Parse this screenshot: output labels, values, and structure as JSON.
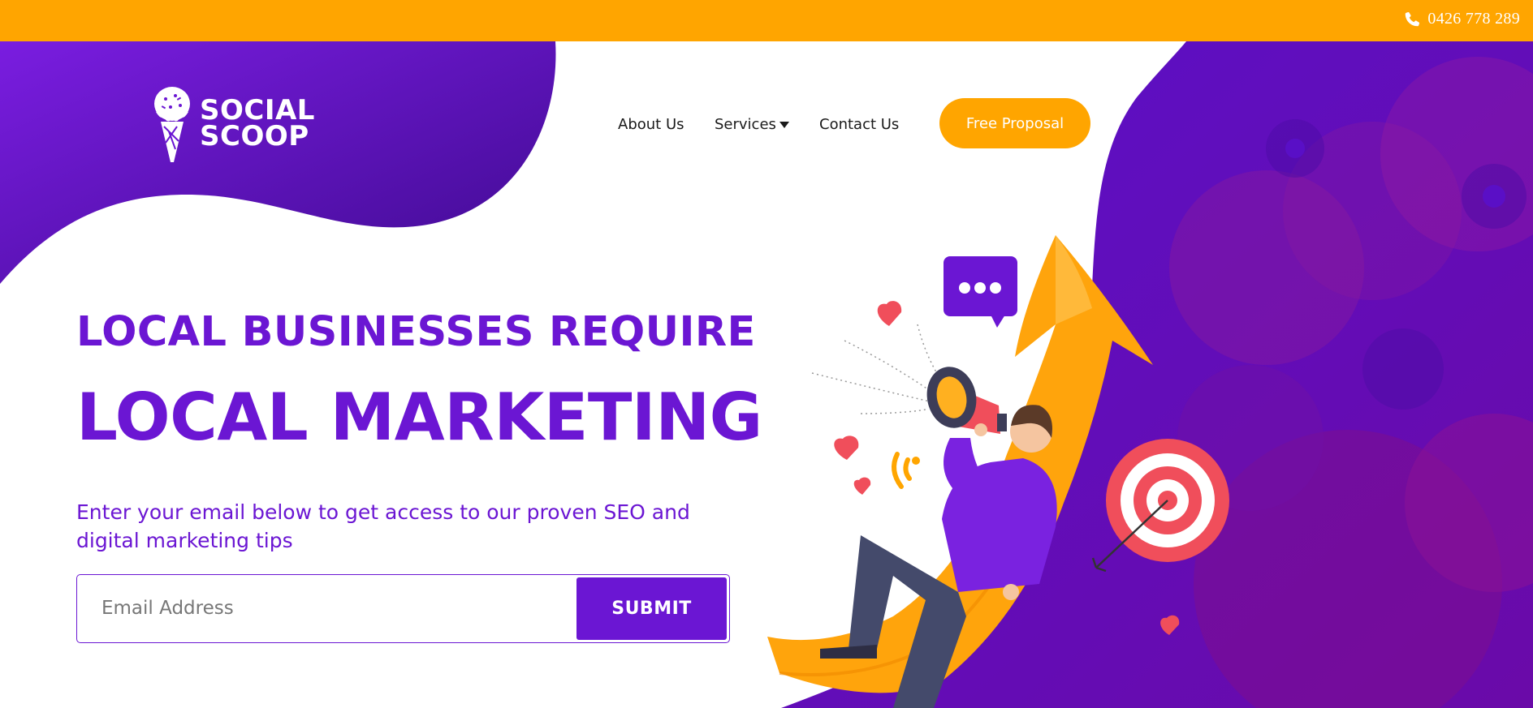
{
  "topbar": {
    "phone_number": "0426 778 289",
    "phone_icon": "phone-icon",
    "color": "#ffa500"
  },
  "logo": {
    "line1": "SOCIAL",
    "line2": "SCOOP",
    "icon": "ice-cream-cone-icon"
  },
  "nav": {
    "items": [
      {
        "label": "About Us"
      },
      {
        "label": "Services"
      },
      {
        "label": "Contact Us"
      }
    ],
    "cta_label": "Free Proposal"
  },
  "hero": {
    "headline_line1": "LOCAL BUSINESSES REQUIRE",
    "headline_line2": "LOCAL MARKETING",
    "subtext": "Enter your email below to get access to our proven SEO and digital marketing tips",
    "email_placeholder": "Email Address",
    "email_value": "",
    "submit_label": "SUBMIT"
  },
  "colors": {
    "brand_purple": "#6b16d3",
    "accent_orange": "#ffa500",
    "heart_red": "#f04e5b"
  }
}
